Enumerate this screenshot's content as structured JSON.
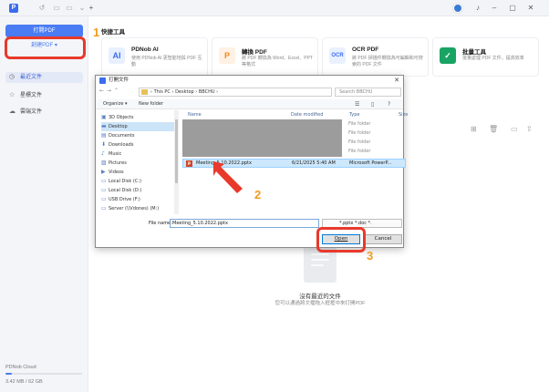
{
  "topbar": {
    "logo": "P",
    "icons": [
      "rotate-left",
      "tab",
      "tab",
      "more",
      "plus"
    ],
    "right_icons": [
      "bell",
      "minus",
      "square",
      "close"
    ]
  },
  "sidebar": {
    "open_pdf": "打開PDF",
    "new_pdf": "創建PDF ▾",
    "items": [
      {
        "label": "最近文件",
        "icon": "clock"
      },
      {
        "label": "星標文件",
        "icon": "star"
      },
      {
        "label": "雲端文件",
        "icon": "cloud"
      }
    ],
    "cloud": {
      "label": "PDNob Cloud",
      "size": "3.42 MB / 62 GB",
      "used_fraction": 0.06
    }
  },
  "main": {
    "section_title": "快捷工具",
    "tools": [
      {
        "name": "PDNob AI",
        "desc": "使用 PDNob AI 更智能地與 PDF 互動",
        "icon": "AI",
        "color": "#e8f0ff",
        "fg": "#3b6cf0"
      },
      {
        "name": "轉換 PDF",
        "desc": "將 PDF 轉換為 Word、Excel、PPT 等格式",
        "icon": "P",
        "color": "#fff1e3",
        "fg": "#f08a1c"
      },
      {
        "name": "OCR PDF",
        "desc": "將 PDF 掃描件轉換為可編輯和可搜索的 PDF 文件",
        "icon": "OCR",
        "color": "#e9f1ff",
        "fg": "#3b6cf0"
      },
      {
        "name": "批量工具",
        "desc": "批量處理 PDF 文件，提高效率",
        "icon": "✓",
        "color": "#e5f7ee",
        "fg": "#19a463"
      }
    ],
    "empty_title": "沒有最近的文件",
    "empty_sub": "您可以通過將文檔拖入框框中來打開PDF"
  },
  "dialog": {
    "title": "打開文件",
    "breadcrumb": "›  This PC  ›  Desktop  ›  BBCHU  ›",
    "search_placeholder": "Search BBCHU",
    "organize": "Organize ▾",
    "new_folder": "New folder",
    "nav": [
      {
        "label": "3D Objects",
        "icon": "▣"
      },
      {
        "label": "Desktop",
        "icon": "▬",
        "selected": true
      },
      {
        "label": "Documents",
        "icon": "▤"
      },
      {
        "label": "Downloads",
        "icon": "⬇"
      },
      {
        "label": "Music",
        "icon": "♪"
      },
      {
        "label": "Pictures",
        "icon": "▨"
      },
      {
        "label": "Videos",
        "icon": "▶"
      },
      {
        "label": "Local Disk (C:)",
        "icon": "▭"
      },
      {
        "label": "Local Disk (D:)",
        "icon": "▭"
      },
      {
        "label": "USB Drive (F:)",
        "icon": "▭"
      },
      {
        "label": "Server (\\\\Vdones) (M:)",
        "icon": "▭"
      }
    ],
    "columns": {
      "name": "Name",
      "date": "Date modified",
      "type": "Type",
      "size": "Size"
    },
    "folder_types": [
      "File folder",
      "File folder",
      "File folder",
      "File folder"
    ],
    "selected_file": {
      "name": "Meeting_5.10.2022.pptx",
      "date": "6/21/2025 5:40 AM",
      "type": "Microsoft PowerP..."
    },
    "file_name_label": "File name:",
    "file_name_value": "Meeting_5.10.2022.pptx",
    "file_type": "*.pptx *.doc *.",
    "open": "Open",
    "cancel": "Cancel"
  },
  "annotations": {
    "step1": "1",
    "step2": "2",
    "step3": "3",
    "color": "#e8392b",
    "step_color": "#f29b22"
  }
}
